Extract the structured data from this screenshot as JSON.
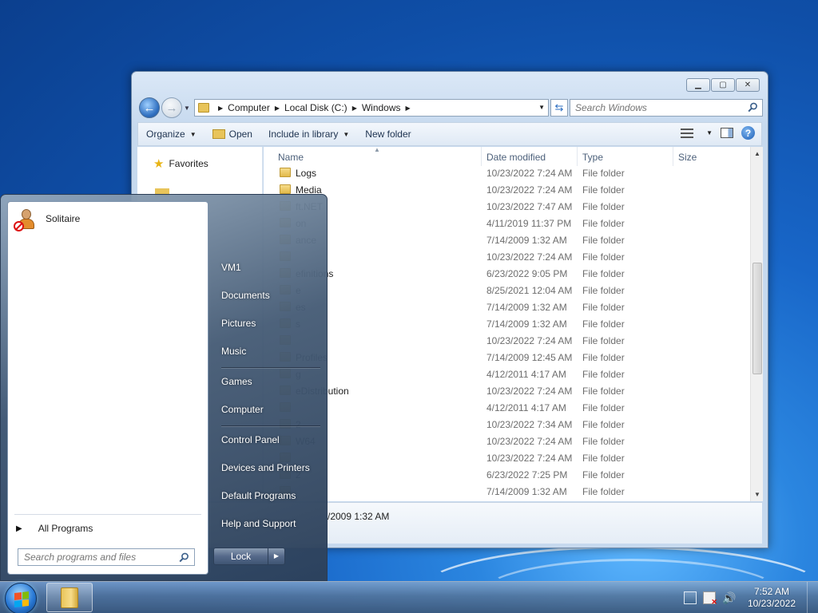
{
  "explorer": {
    "breadcrumb": [
      "Computer",
      "Local Disk (C:)",
      "Windows"
    ],
    "search_placeholder": "Search Windows",
    "toolbar": {
      "organize": "Organize",
      "open": "Open",
      "include_in_library": "Include in library",
      "new_folder": "New folder"
    },
    "nav": {
      "favorites": "Favorites"
    },
    "columns": {
      "name": "Name",
      "date_modified": "Date modified",
      "type": "Type",
      "size": "Size"
    },
    "rows": [
      {
        "name": "Logs",
        "date": "10/23/2022 7:24 AM",
        "type": "File folder"
      },
      {
        "name": "Media",
        "date": "10/23/2022 7:24 AM",
        "type": "File folder"
      },
      {
        "name": "ft.NET",
        "date": "10/23/2022 7:47 AM",
        "type": "File folder"
      },
      {
        "name": "on",
        "date": "4/11/2019 11:37 PM",
        "type": "File folder"
      },
      {
        "name": "ance",
        "date": "7/14/2009 1:32 AM",
        "type": "File folder"
      },
      {
        "name": "",
        "date": "10/23/2022 7:24 AM",
        "type": "File folder"
      },
      {
        "name": "efinitions",
        "date": "6/23/2022 9:05 PM",
        "type": "File folder"
      },
      {
        "name": "e",
        "date": "8/25/2021 12:04 AM",
        "type": "File folder"
      },
      {
        "name": "es",
        "date": "7/14/2009 1:32 AM",
        "type": "File folder"
      },
      {
        "name": "s",
        "date": "7/14/2009 1:32 AM",
        "type": "File folder"
      },
      {
        "name": "",
        "date": "10/23/2022 7:24 AM",
        "type": "File folder"
      },
      {
        "name": "Profiles",
        "date": "7/14/2009 12:45 AM",
        "type": "File folder"
      },
      {
        "name": "g",
        "date": "4/12/2011 4:17 AM",
        "type": "File folder"
      },
      {
        "name": "eDistribution",
        "date": "10/23/2022 7:24 AM",
        "type": "File folder"
      },
      {
        "name": "",
        "date": "4/12/2011 4:17 AM",
        "type": "File folder"
      },
      {
        "name": "2",
        "date": "10/23/2022 7:34 AM",
        "type": "File folder"
      },
      {
        "name": "W64",
        "date": "10/23/2022 7:24 AM",
        "type": "File folder"
      },
      {
        "name": "",
        "date": "10/23/2022 7:24 AM",
        "type": "File folder"
      },
      {
        "name": "2",
        "date": "6/23/2022 7:25 PM",
        "type": "File folder"
      },
      {
        "name": "",
        "date": "7/14/2009 1:32 AM",
        "type": "File folder"
      }
    ],
    "details_text": "/2009 1:32 AM"
  },
  "start_menu": {
    "pinned": [
      {
        "label": "Solitaire",
        "icon": "user-blocked-icon"
      }
    ],
    "all_programs": "All Programs",
    "search_placeholder": "Search programs and files",
    "right_links": {
      "user": "VM1",
      "documents": "Documents",
      "pictures": "Pictures",
      "music": "Music",
      "games": "Games",
      "computer": "Computer",
      "control_panel": "Control Panel",
      "devices_printers": "Devices and Printers",
      "default_programs": "Default Programs",
      "help_support": "Help and Support"
    },
    "lock_label": "Lock"
  },
  "taskbar": {
    "time": "7:52 AM",
    "date": "10/23/2022"
  },
  "colors": {
    "desktop": "#1866c8",
    "accent": "#2f6fc0",
    "start_menu": "#465c76"
  }
}
